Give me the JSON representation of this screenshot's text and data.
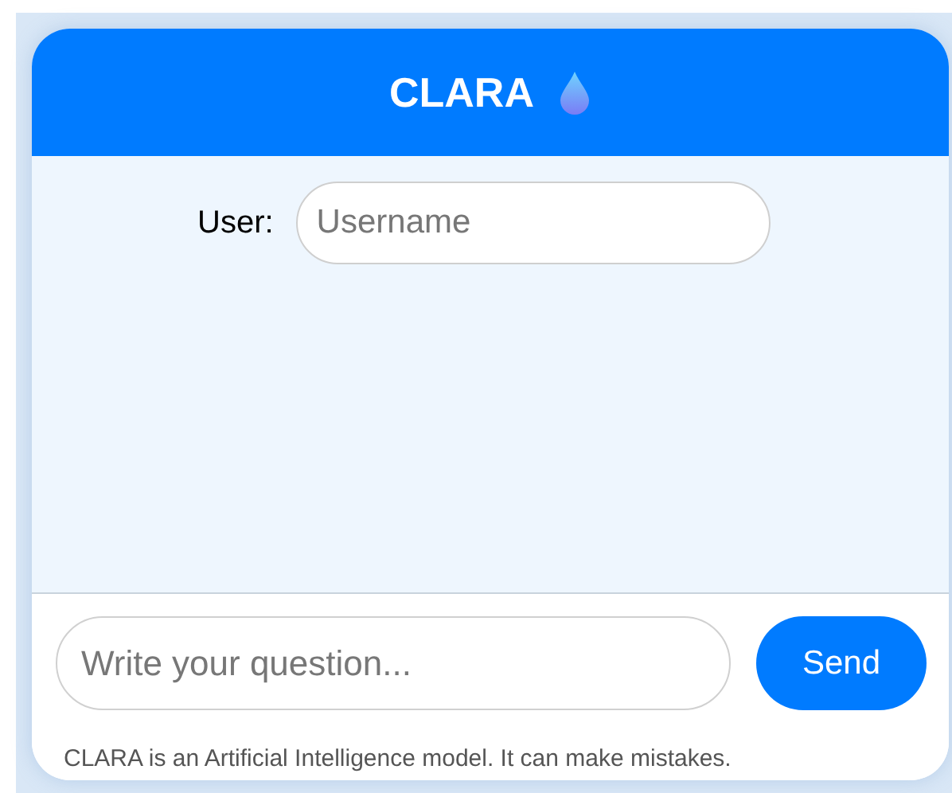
{
  "header": {
    "title": "CLARA"
  },
  "user_field": {
    "label": "User:",
    "placeholder": "Username"
  },
  "composer": {
    "placeholder": "Write your question...",
    "send_label": "Send"
  },
  "disclaimer": "CLARA is an Artificial Intelligence model. It can make mistakes."
}
